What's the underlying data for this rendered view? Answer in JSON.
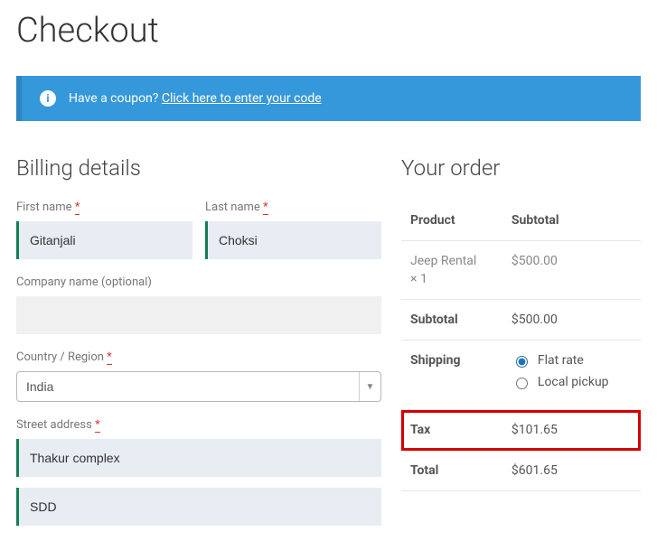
{
  "page_title": "Checkout",
  "coupon": {
    "prompt": "Have a coupon?",
    "link": "Click here to enter your code"
  },
  "billing": {
    "heading": "Billing details",
    "first_name_label": "First name",
    "first_name_value": "Gitanjali",
    "last_name_label": "Last name",
    "last_name_value": "Choksi",
    "company_label": "Company name (optional)",
    "company_value": "",
    "country_label": "Country / Region",
    "country_value": "India",
    "street_label": "Street address",
    "street_value_1": "Thakur complex",
    "street_value_2": "SDD",
    "required_mark": "*"
  },
  "order": {
    "heading": "Your order",
    "col_product": "Product",
    "col_subtotal": "Subtotal",
    "items": [
      {
        "name": "Jeep Rental",
        "qty": "× 1",
        "subtotal": "$500.00"
      }
    ],
    "subtotal_label": "Subtotal",
    "subtotal_value": "$500.00",
    "shipping_label": "Shipping",
    "shipping_options": [
      {
        "label": "Flat rate",
        "selected": true
      },
      {
        "label": "Local pickup",
        "selected": false
      }
    ],
    "tax_label": "Tax",
    "tax_value": "$101.65",
    "total_label": "Total",
    "total_value": "$601.65"
  }
}
